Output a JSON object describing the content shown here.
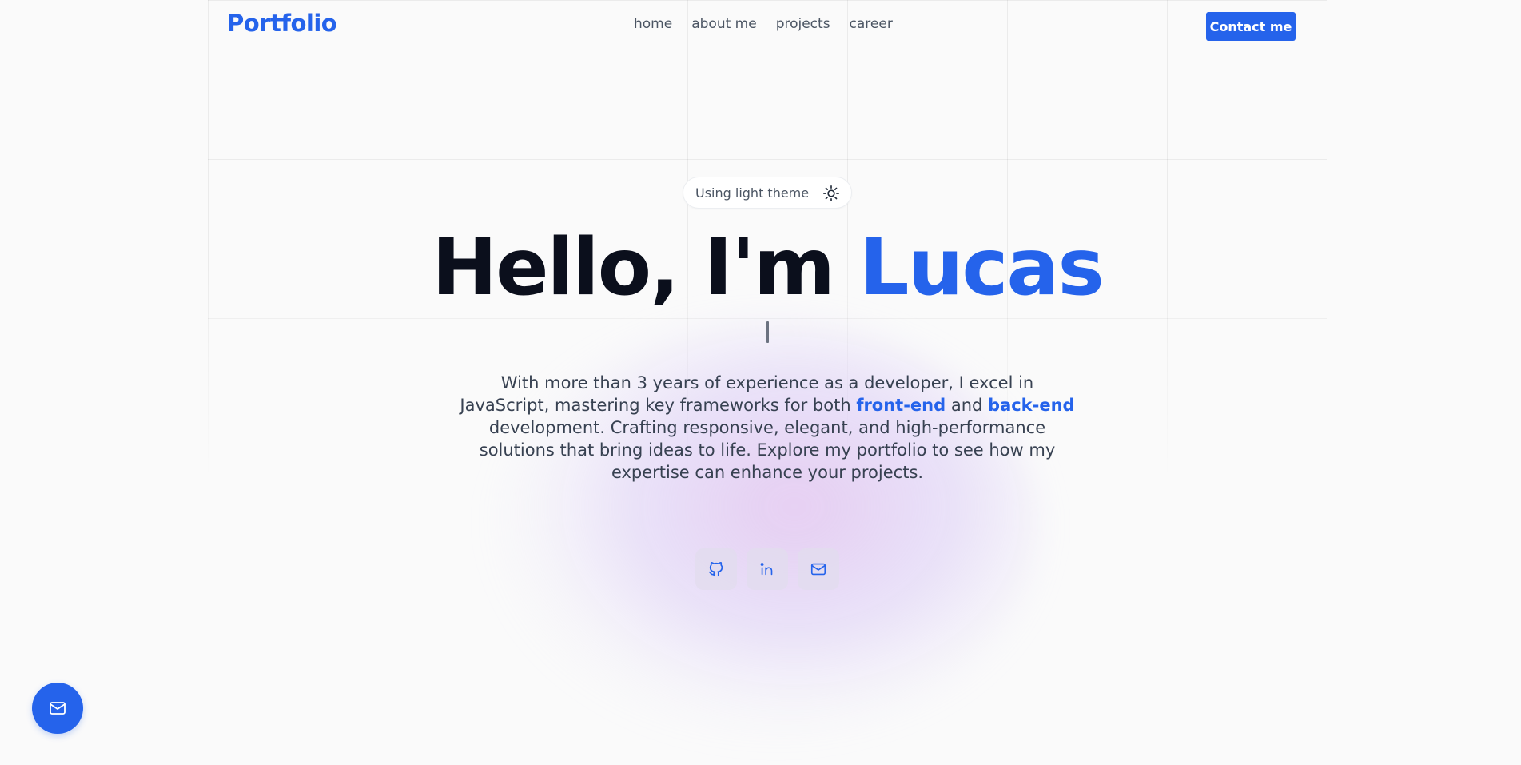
{
  "header": {
    "logo": "Portfolio",
    "nav": [
      {
        "label": "home"
      },
      {
        "label": "about me"
      },
      {
        "label": "projects"
      },
      {
        "label": "career"
      }
    ],
    "contact_label": "Contact me"
  },
  "theme_toggle": {
    "label": "Using light theme",
    "icon": "sun-icon"
  },
  "hero": {
    "greeting": "Hello, I'm ",
    "name": "Lucas"
  },
  "description": {
    "part1": "With more than 3 years of experience as a developer, I excel in JavaScript, mastering key frameworks for both ",
    "highlight1": "front-end",
    "part2": " and ",
    "highlight2": "back-end",
    "part3": " development. Crafting responsive, elegant, and high-performance solutions that bring ideas to life. Explore my portfolio to see how my expertise can enhance your projects."
  },
  "socials": [
    {
      "icon": "github-icon"
    },
    {
      "icon": "linkedin-icon"
    },
    {
      "icon": "mail-icon"
    }
  ],
  "floating_button": {
    "icon": "mail-icon"
  },
  "colors": {
    "accent": "#2563eb",
    "heading": "#0b0f1c",
    "body_text": "#374151",
    "background": "#fafafa"
  }
}
